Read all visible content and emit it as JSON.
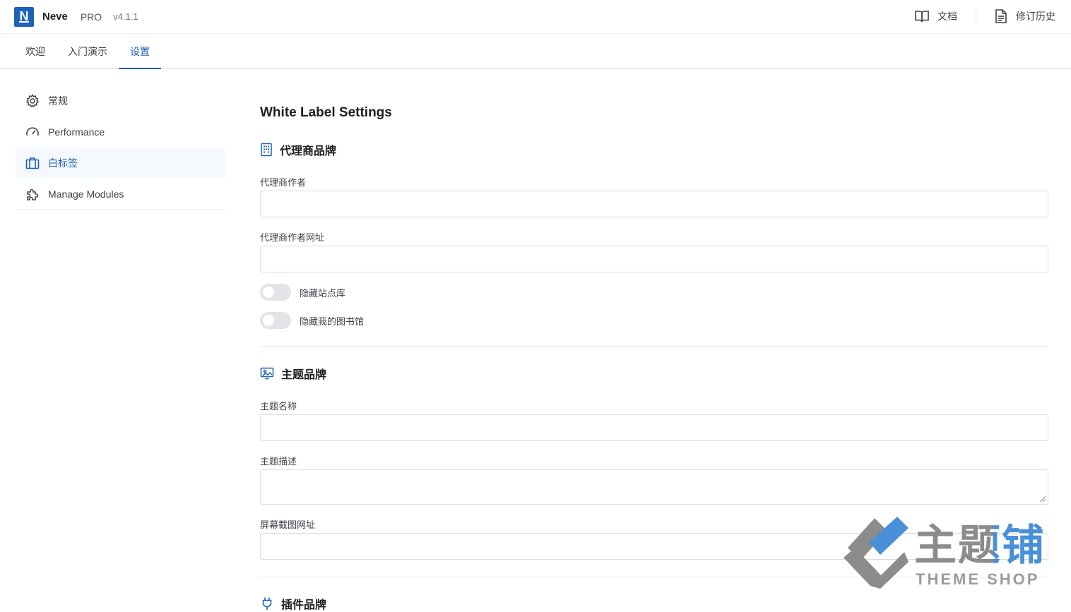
{
  "header": {
    "brand_name": "Neve",
    "brand_tier": "PRO",
    "version": "v4.1.1",
    "actions": [
      {
        "label": "文档",
        "icon": "book-icon"
      },
      {
        "label": "修订历史",
        "icon": "document-icon"
      }
    ]
  },
  "tabs": [
    {
      "label": "欢迎",
      "active": false
    },
    {
      "label": "入门演示",
      "active": false
    },
    {
      "label": "设置",
      "active": true
    }
  ],
  "sidebar": {
    "items": [
      {
        "label": "常规",
        "icon": "gear-icon",
        "active": false
      },
      {
        "label": "Performance",
        "icon": "gauge-icon",
        "active": false
      },
      {
        "label": "白标签",
        "icon": "briefcase-icon",
        "active": true
      },
      {
        "label": "Manage Modules",
        "icon": "puzzle-icon",
        "active": false
      }
    ]
  },
  "main": {
    "title": "White Label Settings",
    "agency": {
      "heading": "代理商品牌",
      "icon": "building-icon",
      "author_label": "代理商作者",
      "author_value": "",
      "author_url_label": "代理商作者网址",
      "author_url_value": "",
      "toggles": [
        {
          "label": "隐藏站点库",
          "on": false
        },
        {
          "label": "隐藏我的图书馆",
          "on": false
        }
      ]
    },
    "theme": {
      "heading": "主题品牌",
      "icon": "monitor-icon",
      "name_label": "主题名称",
      "name_value": "",
      "description_label": "主题描述",
      "description_value": "",
      "screenshot_label": "屏幕截图网址",
      "screenshot_value": ""
    },
    "plugin": {
      "heading": "插件品牌",
      "icon": "plug-icon"
    }
  },
  "watermark": {
    "text": "主题铺",
    "subtext": "THEME SHOP"
  },
  "colors": {
    "accent": "#1d62ba",
    "active_bg": "#f5f8fc",
    "border": "#dcdcde"
  }
}
